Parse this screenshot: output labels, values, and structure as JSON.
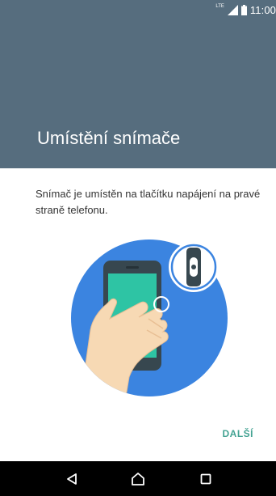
{
  "status_bar": {
    "network_label": "LTE",
    "time": "11:00",
    "icons": [
      "signal-icon",
      "battery-icon"
    ]
  },
  "header": {
    "title": "Umístění snímače"
  },
  "content": {
    "description": "Snímač je umístěn na tlačítku napájení na pravé straně telefonu.",
    "illustration_icons": [
      "phone-in-hand-illustration",
      "fingerprint-sensor-zoom-icon"
    ]
  },
  "actions": {
    "next_label": "DALŠÍ"
  },
  "nav_bar": {
    "items": [
      "back-icon",
      "home-icon",
      "recents-icon"
    ]
  },
  "colors": {
    "header_bg": "#566d7e",
    "accent": "#44a393",
    "illustration_circle": "#3b84e0",
    "phone_screen": "#2ec4a4",
    "hand": "#f7d9b4",
    "nav_bg": "#000000"
  }
}
